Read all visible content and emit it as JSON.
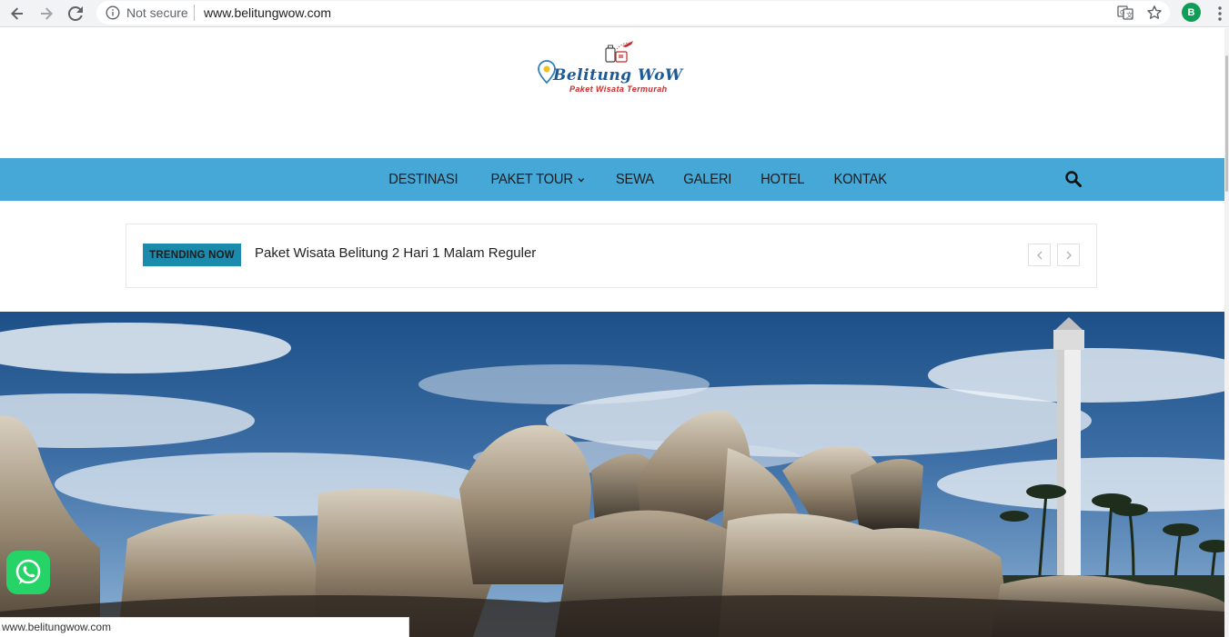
{
  "browser": {
    "security_label": "Not secure",
    "url": "www.belitungwow.com",
    "profile_initial": "B",
    "icons": [
      "back-icon",
      "forward-icon",
      "reload-icon",
      "info-icon",
      "translate-icon",
      "star-icon",
      "menu-dots-icon"
    ]
  },
  "logo": {
    "title": "Belitung WoW",
    "subtitle": "Paket Wisata Termurah"
  },
  "nav": {
    "items": [
      {
        "label": "DESTINASI"
      },
      {
        "label": "PAKET TOUR",
        "has_dropdown": true
      },
      {
        "label": "SEWA"
      },
      {
        "label": "GALERI"
      },
      {
        "label": "HOTEL"
      },
      {
        "label": "KONTAK"
      }
    ],
    "search_icon": "search-icon"
  },
  "trending": {
    "label": "TRENDING NOW",
    "headline": "Paket Wisata Belitung 2 Hari 1 Malam Reguler",
    "prev_icon": "chevron-left-icon",
    "next_icon": "chevron-right-icon"
  },
  "hero": {
    "icon": "beach-rocks-lighthouse-image"
  },
  "whatsapp_icon": "whatsapp-icon",
  "status_bar": {
    "url": "www.belitungwow.com"
  },
  "colors": {
    "nav_bg": "#46a8d6",
    "trend_label_bg": "#1a8aad",
    "whatsapp": "#25d366",
    "logo_blue": "#1e5a96",
    "logo_red": "#c62828"
  }
}
